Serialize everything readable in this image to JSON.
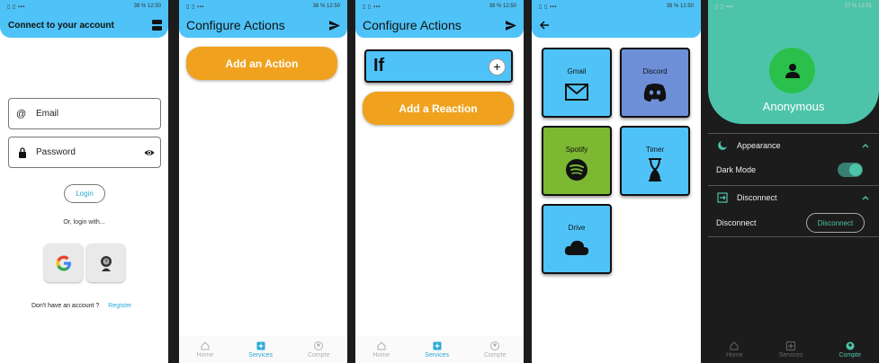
{
  "status": {
    "time": "12:50",
    "time_last": "12:51",
    "battery": "38 %",
    "battery_last": "37 %",
    "left": "▯ ▯ ▪▪▪"
  },
  "login": {
    "title": "Connect to your account",
    "email_placeholder": "Email",
    "password_placeholder": "Password",
    "login_label": "Login",
    "or_text": "Or, login with...",
    "no_account": "Don't have an account ?",
    "register": "Register"
  },
  "configure": {
    "title": "Configure Actions",
    "add_action": "Add an Action",
    "if_label": "If",
    "add_reaction": "Add a Reaction"
  },
  "services": [
    {
      "name": "Gmail",
      "color": "#4fc3f7",
      "icon": "mail-icon"
    },
    {
      "name": "Discord",
      "color": "#6e8fd8",
      "icon": "discord-icon"
    },
    {
      "name": "Spotify",
      "color": "#7cb832",
      "icon": "spotify-icon"
    },
    {
      "name": "Timer",
      "color": "#4fc3f7",
      "icon": "hourglass-icon"
    },
    {
      "name": "Drive",
      "color": "#4fc3f7",
      "icon": "cloud-icon"
    }
  ],
  "account": {
    "username": "Anonymous",
    "appearance": "Appearance",
    "dark_mode": "Dark Mode",
    "dark_mode_on": true,
    "disconnect_section": "Disconnect",
    "disconnect_row": "Disconnect",
    "disconnect_button": "Disconnect"
  },
  "nav": {
    "home": "Home",
    "services": "Services",
    "account": "Compte"
  },
  "colors": {
    "app_bar": "#4fc3f7",
    "orange": "#f0a21f",
    "teal": "#4dc4a9",
    "link": "#2aa9d6"
  }
}
